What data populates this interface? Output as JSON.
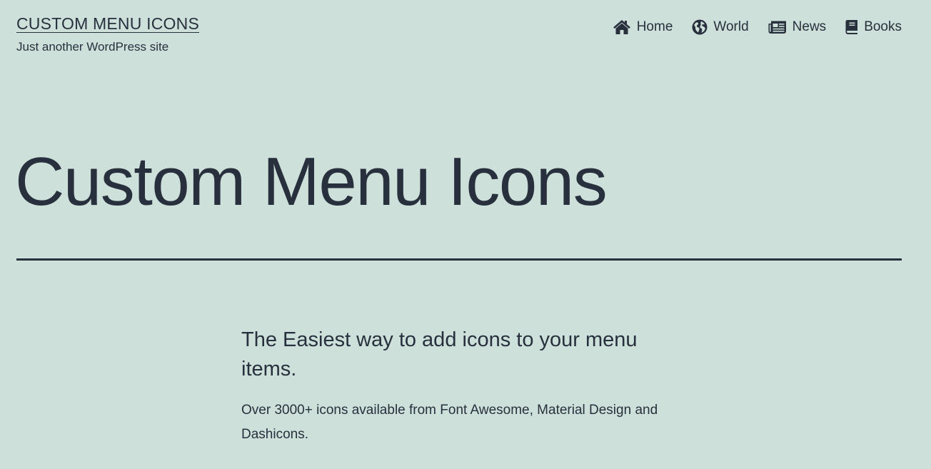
{
  "site": {
    "title": "CUSTOM MENU ICONS",
    "description": "Just another WordPress site"
  },
  "nav": {
    "items": [
      {
        "label": "Home",
        "icon": "home-icon"
      },
      {
        "label": "World",
        "icon": "globe-icon"
      },
      {
        "label": "News",
        "icon": "newspaper-icon"
      },
      {
        "label": "Books",
        "icon": "book-icon"
      }
    ]
  },
  "page": {
    "title": "Custom Menu Icons",
    "lead": "The Easiest way to add icons to your menu items.",
    "body": "Over 3000+ icons available from Font Awesome, Material Design and Dashicons."
  },
  "colors": {
    "background": "#cde0da",
    "text": "#28303d"
  }
}
